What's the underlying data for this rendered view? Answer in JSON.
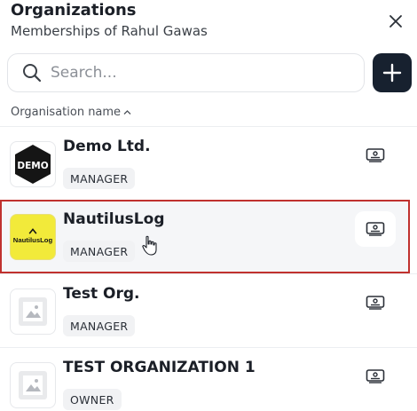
{
  "header": {
    "title": "Organizations",
    "subtitle": "Memberships of Rahul Gawas"
  },
  "search": {
    "placeholder": "Search...",
    "value": ""
  },
  "list_header": {
    "column_label": "Organisation name",
    "sort_indicator": "^"
  },
  "organizations": [
    {
      "name": "Demo Ltd.",
      "role": "MANAGER",
      "logo": "demo-logo",
      "logo_text": "DEMO",
      "selected": false
    },
    {
      "name": "NautilusLog",
      "role": "MANAGER",
      "logo": "nautiluslog-logo",
      "logo_text": "NautilusLog",
      "selected": true
    },
    {
      "name": "Test Org.",
      "role": "MANAGER",
      "logo": "image-placeholder-icon",
      "selected": false
    },
    {
      "name": "TEST ORGANIZATION 1",
      "role": "OWNER",
      "logo": "image-placeholder-icon",
      "selected": false
    }
  ],
  "colors": {
    "accent_dark": "#17212f",
    "selection_border": "#c0312e",
    "nautilus_yellow": "#f2ea3a"
  },
  "icons": {
    "close": "close-icon",
    "search": "search-icon",
    "add": "plus-icon",
    "row_action": "switch-account-icon",
    "sort": "chevron-up-icon"
  }
}
